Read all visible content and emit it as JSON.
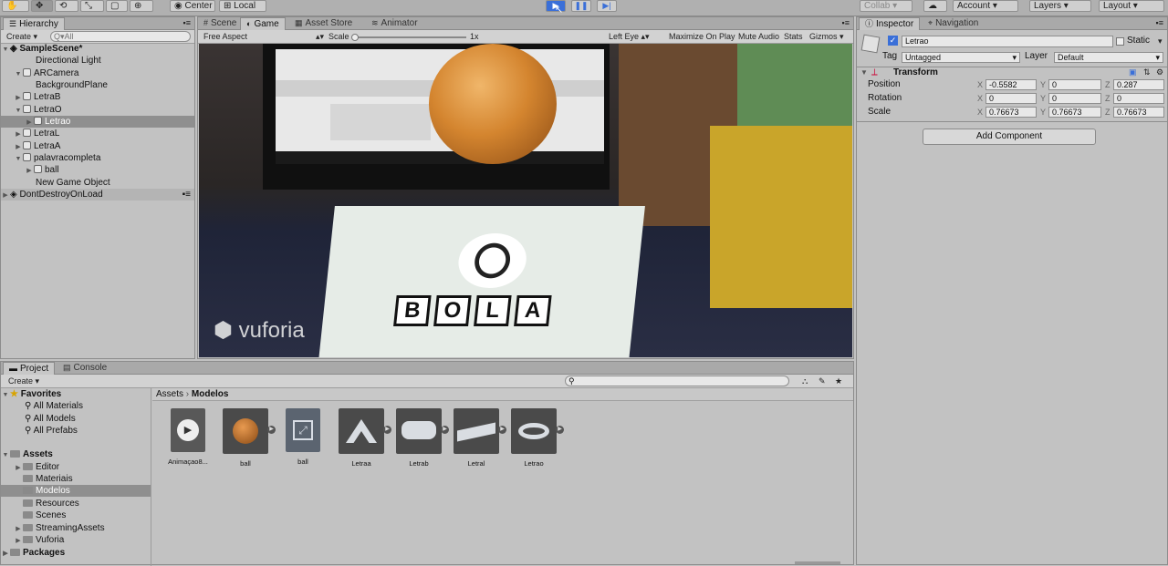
{
  "toolbar": {
    "center_label": "Center",
    "local_label": "Local",
    "play_icon": "▶",
    "pause_icon": "❚❚",
    "step_icon": "▶|",
    "collab_label": "Collab ▾",
    "account_label": "Account",
    "layers_label": "Layers",
    "layout_label": "Layout"
  },
  "hierarchy": {
    "tab_label": "Hierarchy",
    "create_label": "Create",
    "search_placeholder": "Q▾All",
    "items": [
      {
        "label": "SampleScene*"
      },
      {
        "label": "Directional Light"
      },
      {
        "label": "ARCamera"
      },
      {
        "label": "BackgroundPlane"
      },
      {
        "label": "LetraB"
      },
      {
        "label": "LetraO"
      },
      {
        "label": "Letrao"
      },
      {
        "label": "LetraL"
      },
      {
        "label": "LetraA"
      },
      {
        "label": "palavracompleta"
      },
      {
        "label": "ball"
      },
      {
        "label": "New Game Object"
      },
      {
        "label": "DontDestroyOnLoad"
      }
    ]
  },
  "view_tabs": {
    "scene": "Scene",
    "game": "Game",
    "asset_store": "Asset Store",
    "animator": "Animator"
  },
  "game_bar": {
    "aspect": "Free Aspect",
    "scale_label": "Scale",
    "scale_value": "1x",
    "left_eye": "Left Eye",
    "maximize": "Maximize On Play",
    "mute": "Mute Audio",
    "stats": "Stats",
    "gizmos": "Gizmos"
  },
  "game_view": {
    "card_letters": [
      "B",
      "O",
      "L",
      "A"
    ],
    "logo_text": "vuforia"
  },
  "inspector": {
    "tab_label": "Inspector",
    "nav_tab": "Navigation",
    "object_name": "Letrao",
    "static_label": "Static",
    "tag_label": "Tag",
    "tag_value": "Untagged",
    "layer_label": "Layer",
    "layer_value": "Default",
    "transform_label": "Transform",
    "position_label": "Position",
    "rotation_label": "Rotation",
    "scale_label": "Scale",
    "position": {
      "x": "-0.5582",
      "y": "0",
      "z": "0.287"
    },
    "rotation": {
      "x": "0",
      "y": "0",
      "z": "0"
    },
    "scale": {
      "x": "0.76673",
      "y": "0.76673",
      "z": "0.76673"
    },
    "axis_x": "X",
    "axis_y": "Y",
    "axis_z": "Z",
    "add_component": "Add Component"
  },
  "project": {
    "tab_label": "Project",
    "console_tab": "Console",
    "create_label": "Create",
    "favorites_label": "Favorites",
    "fav_items": [
      "All Materials",
      "All Models",
      "All Prefabs"
    ],
    "assets_label": "Assets",
    "asset_folders": [
      "Editor",
      "Materiais",
      "Modelos",
      "Resources",
      "Scenes",
      "StreamingAssets",
      "Vuforia"
    ],
    "packages_label": "Packages",
    "breadcrumb_root": "Assets",
    "breadcrumb_current": "Modelos",
    "files": [
      "Animaçao8...",
      "ball",
      "ball",
      "Letraa",
      "Letrab",
      "Letral",
      "Letrao"
    ]
  }
}
